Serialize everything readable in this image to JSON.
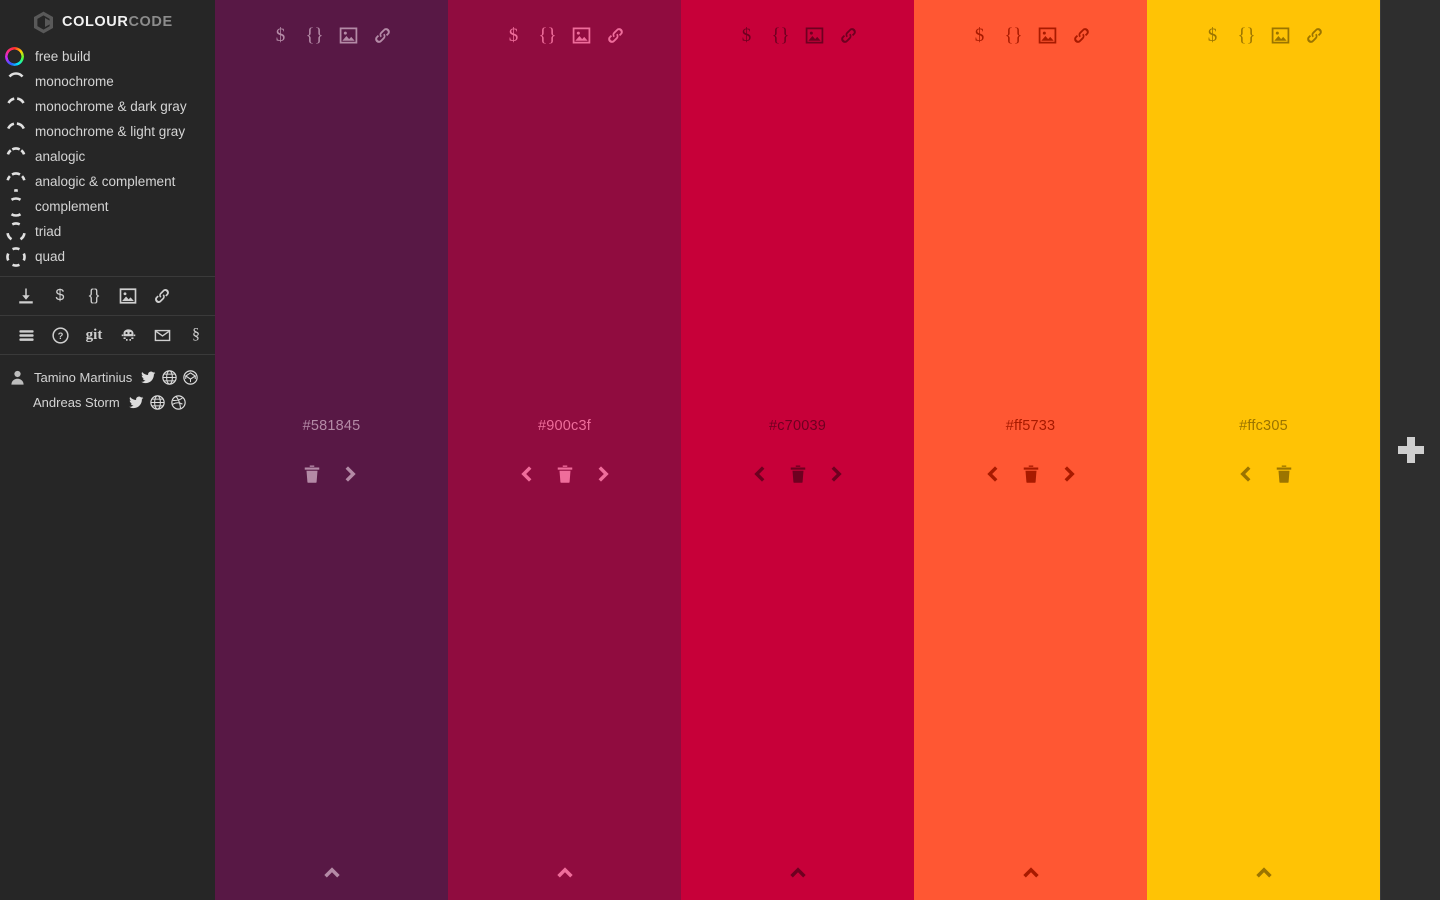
{
  "app": {
    "brand_primary": "COLOUR",
    "brand_secondary": "CODE",
    "background": "#262626",
    "strip_background": "#2e2e2e"
  },
  "sidebar": {
    "schemes": [
      {
        "label": "free build",
        "icon": "colour-wheel-icon",
        "selected": true
      },
      {
        "label": "monochrome",
        "icon": "arc-monochrome-icon",
        "selected": false
      },
      {
        "label": "monochrome & dark gray",
        "icon": "arc-monochrome-dark-gray-icon",
        "selected": false
      },
      {
        "label": "monochrome & light gray",
        "icon": "arc-monochrome-light-gray-icon",
        "selected": false
      },
      {
        "label": "analogic",
        "icon": "arc-analogic-icon",
        "selected": false
      },
      {
        "label": "analogic & complement",
        "icon": "arc-analogic-complement-icon",
        "selected": false
      },
      {
        "label": "complement",
        "icon": "arc-complement-icon",
        "selected": false
      },
      {
        "label": "triad",
        "icon": "arc-triad-icon",
        "selected": false
      },
      {
        "label": "quad",
        "icon": "arc-quad-icon",
        "selected": false
      }
    ],
    "export_tools": [
      {
        "name": "download-icon",
        "glyph": ""
      },
      {
        "name": "dollar-icon",
        "glyph": "$"
      },
      {
        "name": "braces-icon",
        "glyph": "{}"
      },
      {
        "name": "image-icon",
        "glyph": ""
      },
      {
        "name": "link-icon",
        "glyph": ""
      }
    ],
    "info_tools": [
      {
        "name": "menu-icon",
        "glyph": ""
      },
      {
        "name": "help-icon",
        "glyph": "?"
      },
      {
        "name": "git-icon",
        "glyph": "git"
      },
      {
        "name": "bug-icon",
        "glyph": ""
      },
      {
        "name": "mail-icon",
        "glyph": ""
      },
      {
        "name": "section-icon",
        "glyph": "§"
      }
    ],
    "credits": [
      {
        "name": "Tamino Martinius",
        "links": [
          "twitter-icon",
          "globe-icon",
          "codepen-icon"
        ]
      },
      {
        "name": "Andreas Storm",
        "links": [
          "twitter-icon",
          "globe-icon",
          "dribbble-icon"
        ]
      }
    ]
  },
  "columns": [
    {
      "hex": "#581845",
      "background": "#581845",
      "foreground": "#b48aa6",
      "icons": [
        "dollar-icon",
        "braces-icon",
        "image-icon",
        "link-icon"
      ],
      "controls": [
        "delete-icon",
        "move-right-icon"
      ],
      "has_move_left": false,
      "has_move_right": true,
      "collapse": "collapse-up-icon"
    },
    {
      "hex": "#900c3f",
      "background": "#900c3f",
      "foreground": "#ef6d9b",
      "icons": [
        "dollar-icon",
        "braces-icon",
        "image-icon",
        "link-icon"
      ],
      "controls": [
        "move-left-icon",
        "delete-icon",
        "move-right-icon"
      ],
      "has_move_left": true,
      "has_move_right": true,
      "collapse": "collapse-up-icon"
    },
    {
      "hex": "#c70039",
      "background": "#c70039",
      "foreground": "#6e0020",
      "icons": [
        "dollar-icon",
        "braces-icon",
        "image-icon",
        "link-icon"
      ],
      "controls": [
        "move-left-icon",
        "delete-icon",
        "move-right-icon"
      ],
      "has_move_left": true,
      "has_move_right": true,
      "collapse": "collapse-up-icon"
    },
    {
      "hex": "#ff5733",
      "background": "#ff5733",
      "foreground": "#a81a00",
      "icons": [
        "dollar-icon",
        "braces-icon",
        "image-icon",
        "link-icon"
      ],
      "controls": [
        "move-left-icon",
        "delete-icon",
        "move-right-icon"
      ],
      "has_move_left": true,
      "has_move_right": true,
      "collapse": "collapse-up-icon"
    },
    {
      "hex": "#ffc305",
      "background": "#ffc305",
      "foreground": "#9b7400",
      "icons": [
        "dollar-icon",
        "braces-icon",
        "image-icon",
        "link-icon"
      ],
      "controls": [
        "move-left-icon",
        "delete-icon"
      ],
      "has_move_left": true,
      "has_move_right": false,
      "collapse": "collapse-up-icon"
    }
  ],
  "add_column": {
    "name": "add-colour-button",
    "icon": "plus-icon"
  }
}
